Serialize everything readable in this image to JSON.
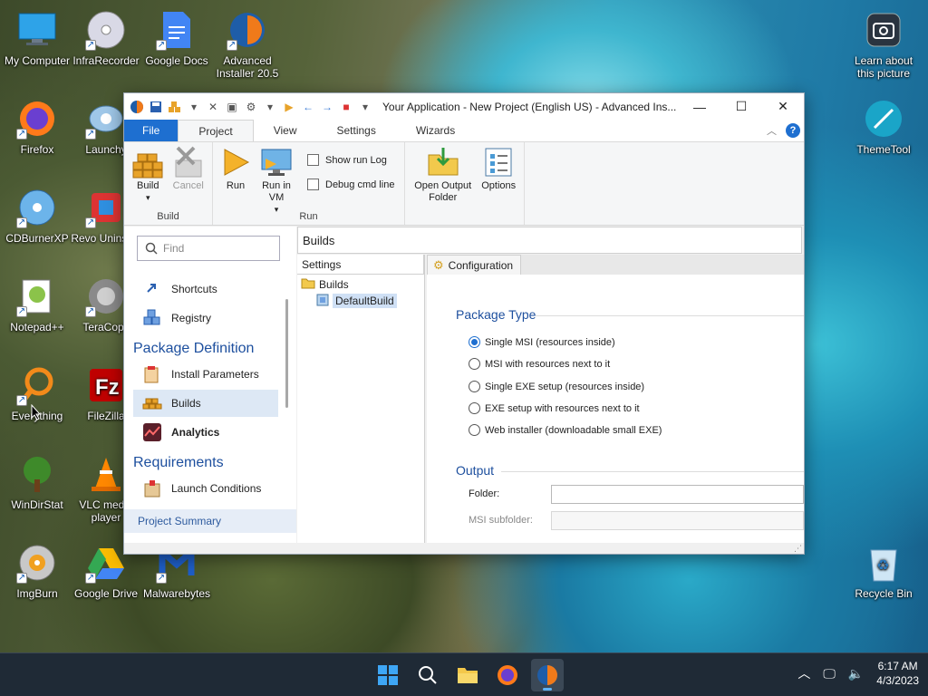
{
  "desktop": {
    "icons_left": [
      {
        "label": "My Computer"
      },
      {
        "label": "InfraRecorder"
      },
      {
        "label": "Google Docs"
      },
      {
        "label": "Advanced Installer 20.5"
      },
      {
        "label": "Firefox"
      },
      {
        "label": "Launchy"
      },
      {
        "label": "CDBurnerXP"
      },
      {
        "label": "Revo Uninstall"
      },
      {
        "label": "Notepad++"
      },
      {
        "label": "TeraCopy"
      },
      {
        "label": "Everything"
      },
      {
        "label": "FileZilla"
      },
      {
        "label": "WinDirStat"
      },
      {
        "label": "VLC media player"
      },
      {
        "label": "ImgBurn"
      },
      {
        "label": "Google Drive"
      },
      {
        "label": "Malwarebytes"
      }
    ],
    "icons_right": [
      {
        "label": "Learn about this picture"
      },
      {
        "label": "ThemeTool"
      },
      {
        "label": "Recycle Bin"
      }
    ]
  },
  "window": {
    "title": "Your Application - New Project (English US) - Advanced Ins...",
    "tabs": [
      "File",
      "Project",
      "View",
      "Settings",
      "Wizards"
    ],
    "active_tab": "Project",
    "ribbon": {
      "build_group": {
        "label": "Build",
        "build": "Build",
        "cancel": "Cancel"
      },
      "run_group": {
        "label": "Run",
        "run": "Run",
        "run_in_vm": "Run in VM",
        "show_run_log": "Show run Log",
        "debug_cmd_line": "Debug cmd line"
      },
      "misc_group": {
        "open_output_folder": "Open Output Folder",
        "options": "Options"
      }
    },
    "left_panel": {
      "find_placeholder": "Find",
      "items_top": [
        "Shortcuts",
        "Registry"
      ],
      "package_definition_heading": "Package Definition",
      "package_items": [
        "Install Parameters",
        "Builds",
        "Analytics"
      ],
      "selected_item": "Builds",
      "requirements_heading": "Requirements",
      "requirements_items": [
        "Launch Conditions"
      ],
      "project_summary": "Project Summary"
    },
    "right_panel": {
      "header": "Builds",
      "tree_header": "Settings",
      "tree": {
        "root": "Builds",
        "child": "DefaultBuild"
      },
      "config_tab": "Configuration",
      "package_type_title": "Package Type",
      "package_types": [
        "Single MSI (resources inside)",
        "MSI with resources next to it",
        "Single EXE setup (resources inside)",
        "EXE setup with resources next to it",
        "Web installer (downloadable small EXE)"
      ],
      "selected_package_type_index": 0,
      "output_title": "Output",
      "folder_label": "Folder:",
      "folder_value": "",
      "msi_subfolder_label": "MSI subfolder:",
      "msi_subfolder_value": ""
    }
  },
  "taskbar": {
    "time": "6:17 AM",
    "date": "4/3/2023"
  },
  "colors": {
    "accent": "#1e6fd0",
    "heading": "#1d4f9e",
    "taskbar": "#1f2a36"
  }
}
